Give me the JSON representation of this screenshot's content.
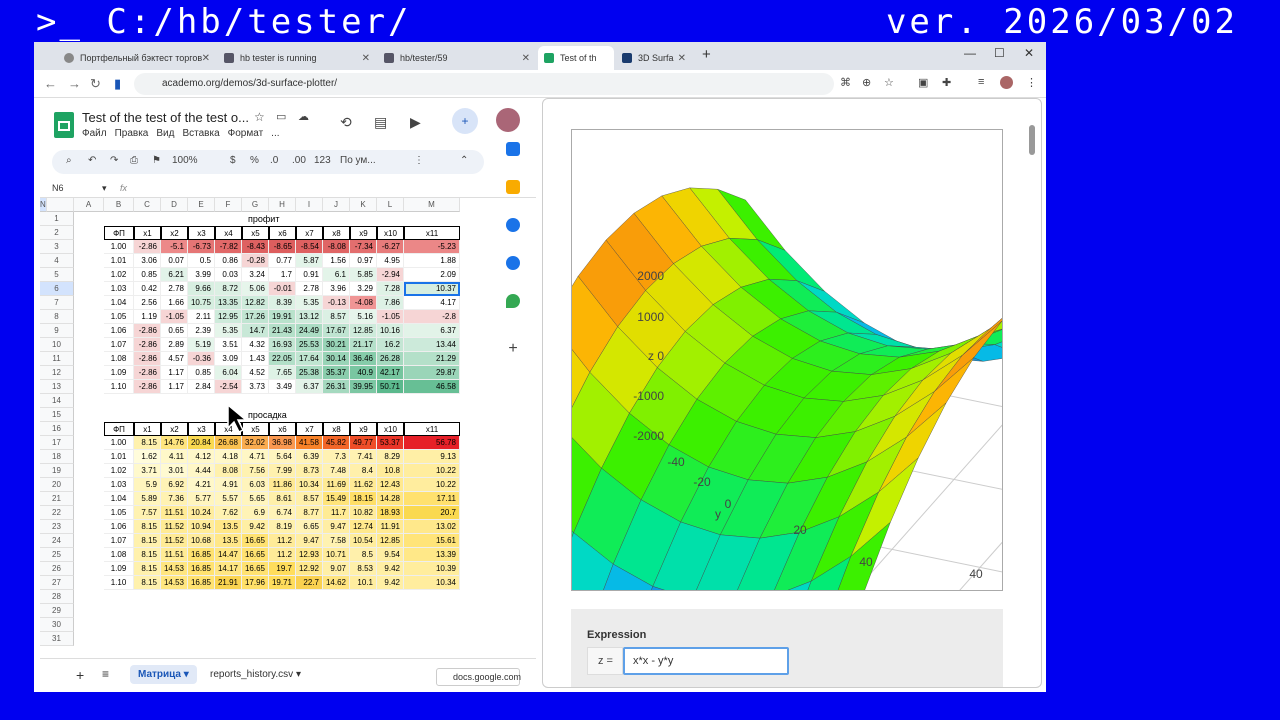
{
  "banner": {
    "left": ">_ C:/hb/tester/",
    "right": "ver. 2026/03/02"
  },
  "tabs": [
    {
      "title": "Портфельный бэктест торгов",
      "color": "#666"
    },
    {
      "title": "hb tester is running",
      "color": "#555"
    },
    {
      "title": "hb/tester/59",
      "color": "#555"
    },
    {
      "title": "Test of th",
      "color": "#1ea362",
      "active": true
    },
    {
      "title": "3D Surfa",
      "color": "#1a3b6e"
    }
  ],
  "url": "academo.org/demos/3d-surface-plotter/",
  "sheet": {
    "title": "Test of the test of the test o...",
    "menus": [
      "Файл",
      "Правка",
      "Вид",
      "Вставка",
      "Формат",
      "..."
    ],
    "zoom": "100%",
    "font": "По ум...",
    "cell_ref": "N6",
    "fx": "fx",
    "col_letters": [
      "A",
      "B",
      "C",
      "D",
      "E",
      "F",
      "G",
      "H",
      "I",
      "J",
      "K",
      "L",
      "M",
      "N"
    ],
    "profit_title": "профит",
    "drawdown_title": "просадка",
    "headers": [
      "ФП",
      "x1",
      "x2",
      "x3",
      "x4",
      "x5",
      "x6",
      "x7",
      "x8",
      "x9",
      "x10",
      "x11"
    ],
    "profit_rows": [
      [
        "1.00",
        "-2.86",
        "-5.1",
        "-6.73",
        "-7.82",
        "-8.43",
        "-8.65",
        "-8.54",
        "-8.08",
        "-7.34",
        "-6.27",
        "-5.23"
      ],
      [
        "1.01",
        "3.06",
        "0.07",
        "0.5",
        "0.86",
        "-0.28",
        "0.77",
        "5.87",
        "1.56",
        "0.97",
        "4.95",
        "1.88"
      ],
      [
        "1.02",
        "0.85",
        "6.21",
        "3.99",
        "0.03",
        "3.24",
        "1.7",
        "0.91",
        "6.1",
        "5.85",
        "-2.94",
        "2.09"
      ],
      [
        "1.03",
        "0.42",
        "2.78",
        "9.66",
        "8.72",
        "5.06",
        "-0.01",
        "2.78",
        "3.96",
        "3.29",
        "7.28",
        "10.37"
      ],
      [
        "1.04",
        "2.56",
        "1.66",
        "10.75",
        "13.35",
        "12.82",
        "8.39",
        "5.35",
        "-0.13",
        "-4.08",
        "7.86",
        "4.17"
      ],
      [
        "1.05",
        "1.19",
        "-1.05",
        "2.11",
        "12.95",
        "17.26",
        "19.91",
        "13.12",
        "8.57",
        "5.16",
        "-1.05",
        "-2.8"
      ],
      [
        "1.06",
        "-2.86",
        "0.65",
        "2.39",
        "5.35",
        "14.7",
        "21.43",
        "24.49",
        "17.67",
        "12.85",
        "10.16",
        "6.37"
      ],
      [
        "1.07",
        "-2.86",
        "2.89",
        "5.19",
        "3.51",
        "4.32",
        "16.93",
        "25.53",
        "30.21",
        "21.17",
        "16.2",
        "13.44"
      ],
      [
        "1.08",
        "-2.86",
        "4.57",
        "-0.36",
        "3.09",
        "1.43",
        "22.05",
        "17.64",
        "30.14",
        "36.46",
        "26.28",
        "21.29"
      ],
      [
        "1.09",
        "-2.86",
        "1.17",
        "0.85",
        "6.04",
        "4.52",
        "7.65",
        "25.38",
        "35.37",
        "40.9",
        "42.17",
        "29.87"
      ],
      [
        "1.10",
        "-2.86",
        "1.17",
        "2.84",
        "-2.54",
        "3.73",
        "3.49",
        "6.37",
        "26.31",
        "39.95",
        "50.71",
        "46.58"
      ]
    ],
    "drawdown_rows": [
      [
        "1.00",
        "8.15",
        "14.76",
        "20.84",
        "26.68",
        "32.02",
        "36.98",
        "41.58",
        "45.82",
        "49.77",
        "53.37",
        "56.78"
      ],
      [
        "1.01",
        "1.62",
        "4.11",
        "4.12",
        "4.18",
        "4.71",
        "5.64",
        "6.39",
        "7.3",
        "7.41",
        "8.29",
        "9.13"
      ],
      [
        "1.02",
        "3.71",
        "3.01",
        "4.44",
        "8.08",
        "7.56",
        "7.99",
        "8.73",
        "7.48",
        "8.4",
        "10.8",
        "10.22"
      ],
      [
        "1.03",
        "5.9",
        "6.92",
        "4.21",
        "4.91",
        "6.03",
        "11.86",
        "10.34",
        "11.69",
        "11.62",
        "12.43",
        "10.22"
      ],
      [
        "1.04",
        "5.89",
        "7.36",
        "5.77",
        "5.57",
        "5.65",
        "8.61",
        "8.57",
        "15.49",
        "18.15",
        "14.28",
        "17.11"
      ],
      [
        "1.05",
        "7.57",
        "11.51",
        "10.24",
        "7.62",
        "6.9",
        "6.74",
        "8.77",
        "11.7",
        "10.82",
        "18.93",
        "20.7"
      ],
      [
        "1.06",
        "8.15",
        "11.52",
        "10.94",
        "13.5",
        "9.42",
        "8.19",
        "6.65",
        "9.47",
        "12.74",
        "11.91",
        "13.02"
      ],
      [
        "1.07",
        "8.15",
        "11.52",
        "10.68",
        "13.5",
        "16.65",
        "11.2",
        "9.47",
        "7.58",
        "10.54",
        "12.85",
        "15.61"
      ],
      [
        "1.08",
        "8.15",
        "11.51",
        "16.85",
        "14.47",
        "16.65",
        "11.2",
        "12.93",
        "10.71",
        "8.5",
        "9.54",
        "13.39"
      ],
      [
        "1.09",
        "8.15",
        "14.53",
        "16.85",
        "14.17",
        "16.65",
        "19.7",
        "12.92",
        "9.07",
        "8.53",
        "9.42",
        "10.39"
      ],
      [
        "1.10",
        "8.15",
        "14.53",
        "16.85",
        "21.91",
        "17.96",
        "19.71",
        "22.7",
        "14.62",
        "10.1",
        "9.42",
        "10.34"
      ]
    ],
    "sheet_tabs": [
      "Матрица",
      "reports_history.csv"
    ],
    "docs_pill": "docs.google.com"
  },
  "plot": {
    "z_ticks": [
      "2000",
      "1000",
      "z 0",
      "-1000",
      "-2000"
    ],
    "y_ticks": [
      "-40",
      "-20",
      "0",
      "20",
      "40"
    ],
    "x_ticks": [
      "40"
    ],
    "y_label": "y",
    "expr_label": "Expression",
    "z_prefix": "z =",
    "expression": "x*x - y*y"
  },
  "colors": {
    "banner_bg": "#0000f0",
    "accent": "#1a56b7",
    "sheets_green": "#1ea362"
  }
}
